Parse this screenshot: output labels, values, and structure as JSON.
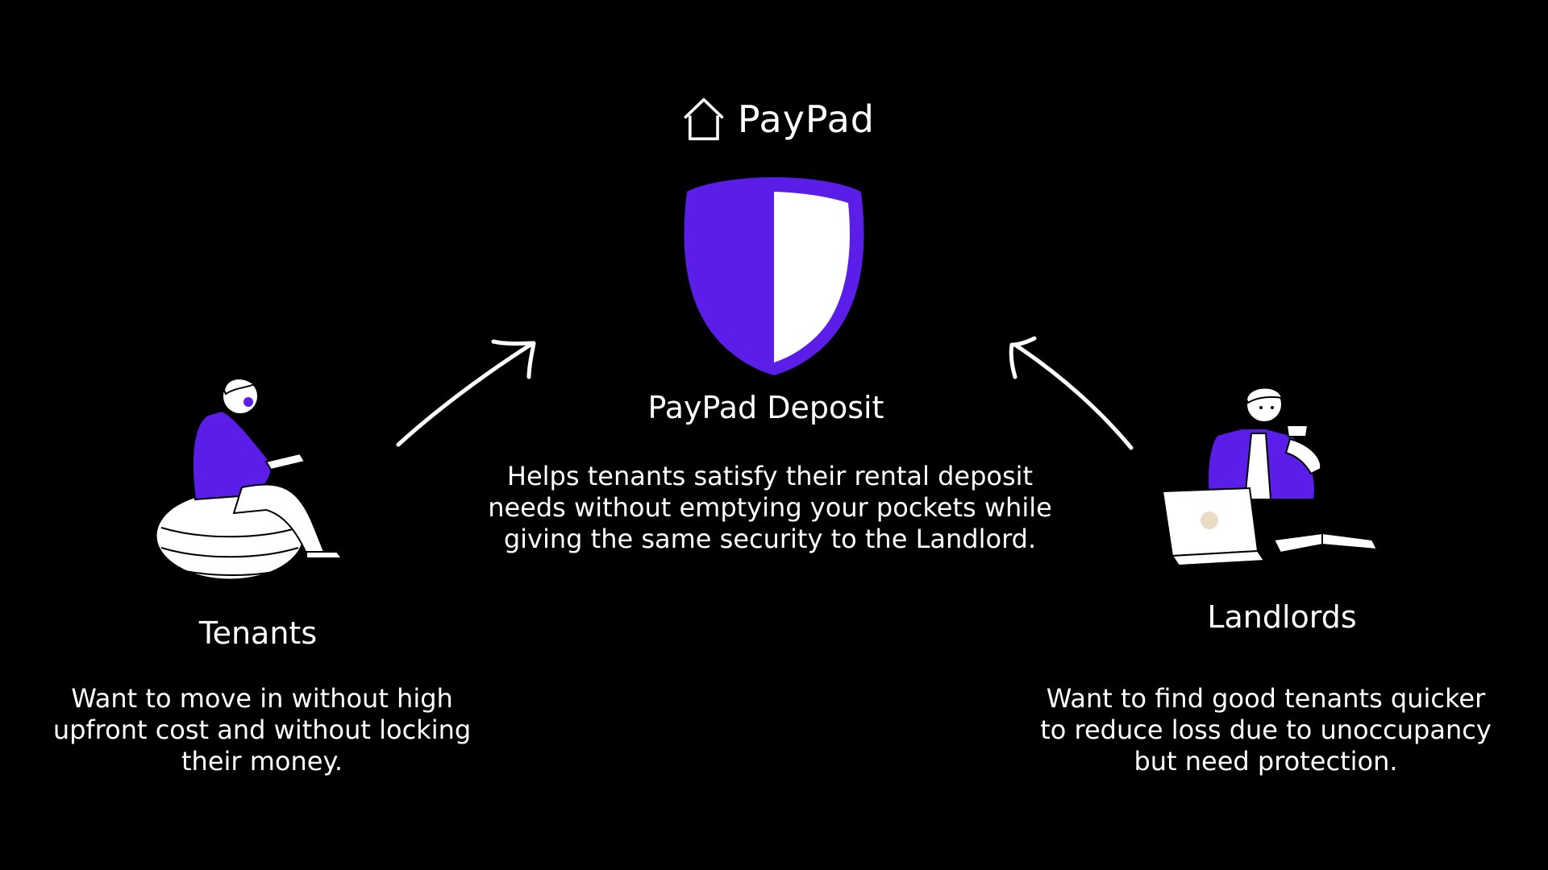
{
  "brand": {
    "name": "PayPad",
    "accent": "#5b1de8",
    "logo_icon": "house-outline-icon"
  },
  "center": {
    "title": "PayPad Deposit",
    "description": "Helps tenants satisfy their rental deposit needs without emptying your pockets while giving the same security to the Landlord.",
    "icon": "shield-icon"
  },
  "tenants": {
    "title": "Tenants",
    "description": "Want to move in without high upfront cost and without locking their money.",
    "icon": "person-reading-on-beanbag-illustration"
  },
  "landlords": {
    "title": "Landlords",
    "description": "Want to find good tenants quicker to reduce loss due to unoccupancy but need protection.",
    "icon": "person-with-laptop-and-coffee-illustration"
  },
  "colors": {
    "background": "#000000",
    "text": "#ffffff",
    "accent": "#5b1de8"
  }
}
